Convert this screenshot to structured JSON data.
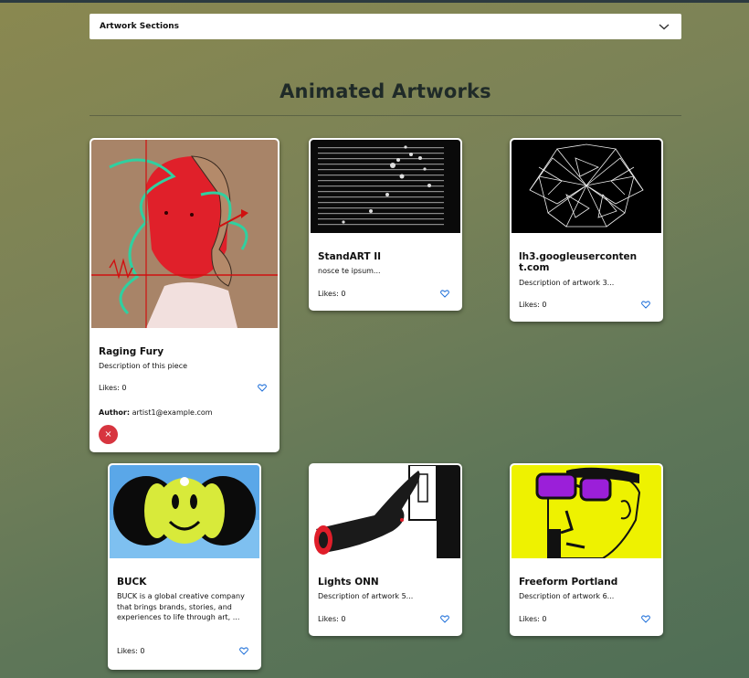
{
  "dropdown": {
    "label": "Artwork Sections"
  },
  "section": {
    "title": "Animated Artworks"
  },
  "colors": {
    "heart": "#1e6fd9",
    "delete": "#d7353f",
    "card_bg": "#ffffff"
  },
  "cards": [
    {
      "title": "Raging Fury",
      "description": "Description of this piece",
      "likes": "Likes: 0",
      "author_label": "Author:",
      "author": "artist1@example.com",
      "delete_icon": "×"
    },
    {
      "title": "StandART II",
      "description": "nosce te ipsum...",
      "likes": "Likes: 0"
    },
    {
      "title": "lh3.googleuserconten t.com",
      "description": "Description of artwork 3...",
      "likes": "Likes: 0"
    },
    {
      "title": "BUCK",
      "description": "BUCK is a global creative company that brings brands, stories, and experiences to life through art, ...",
      "likes": "Likes: 0"
    },
    {
      "title": "Lights ONN",
      "description": "Description of artwork 5...",
      "likes": "Likes: 0"
    },
    {
      "title": "Freeform Portland",
      "description": "Description of artwork 6...",
      "likes": "Likes: 0"
    }
  ]
}
